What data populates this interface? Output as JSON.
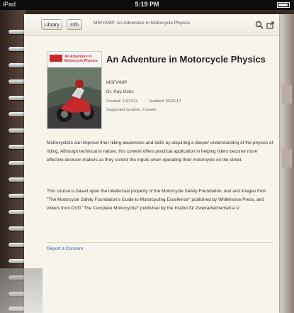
{
  "status_bar": {
    "carrier": "iPad",
    "time": "5:19 PM"
  },
  "toolbar": {
    "library_label": "Library",
    "info_label": "Info",
    "title": "MSF/AMP: An Adventure in Motorcycle Physics"
  },
  "course": {
    "cover_title": "An Adventure in Motorcycle Physics",
    "title": "An Adventure in Motorcycle Physics",
    "provider": "MSF/AMP",
    "author": "Dr. Ray Ochs",
    "created": "Created: 1/3/1913",
    "updated": "Updated: 06/01/13",
    "duration": "Suggested duration: 3 weeks",
    "description": "Motorcyclists can improve their riding awareness and skills by acquiring a deeper understanding of the physics of riding. Although technical in nature, this content offers practical application in helping riders become more effective decision-makers as they control the inputs when operating their motorcycle on the street.",
    "attribution": "This course is based upon the intellectual property of the Motorcycle Safety Foundation, text and images from \"The Motorcycle Safety Foundation's Guide to Motorcycling Excellence\" published by Whitehorse Press, and videos from DVD \"The Complete Motorcyclist\" published by the Institut für Zweiradsicherheit e.V.",
    "report_link": "Report a Concern"
  },
  "icons": [
    "search-icon",
    "share-icon"
  ],
  "colors": {
    "link": "#2a64b6",
    "brand_red": "#c9262c"
  }
}
